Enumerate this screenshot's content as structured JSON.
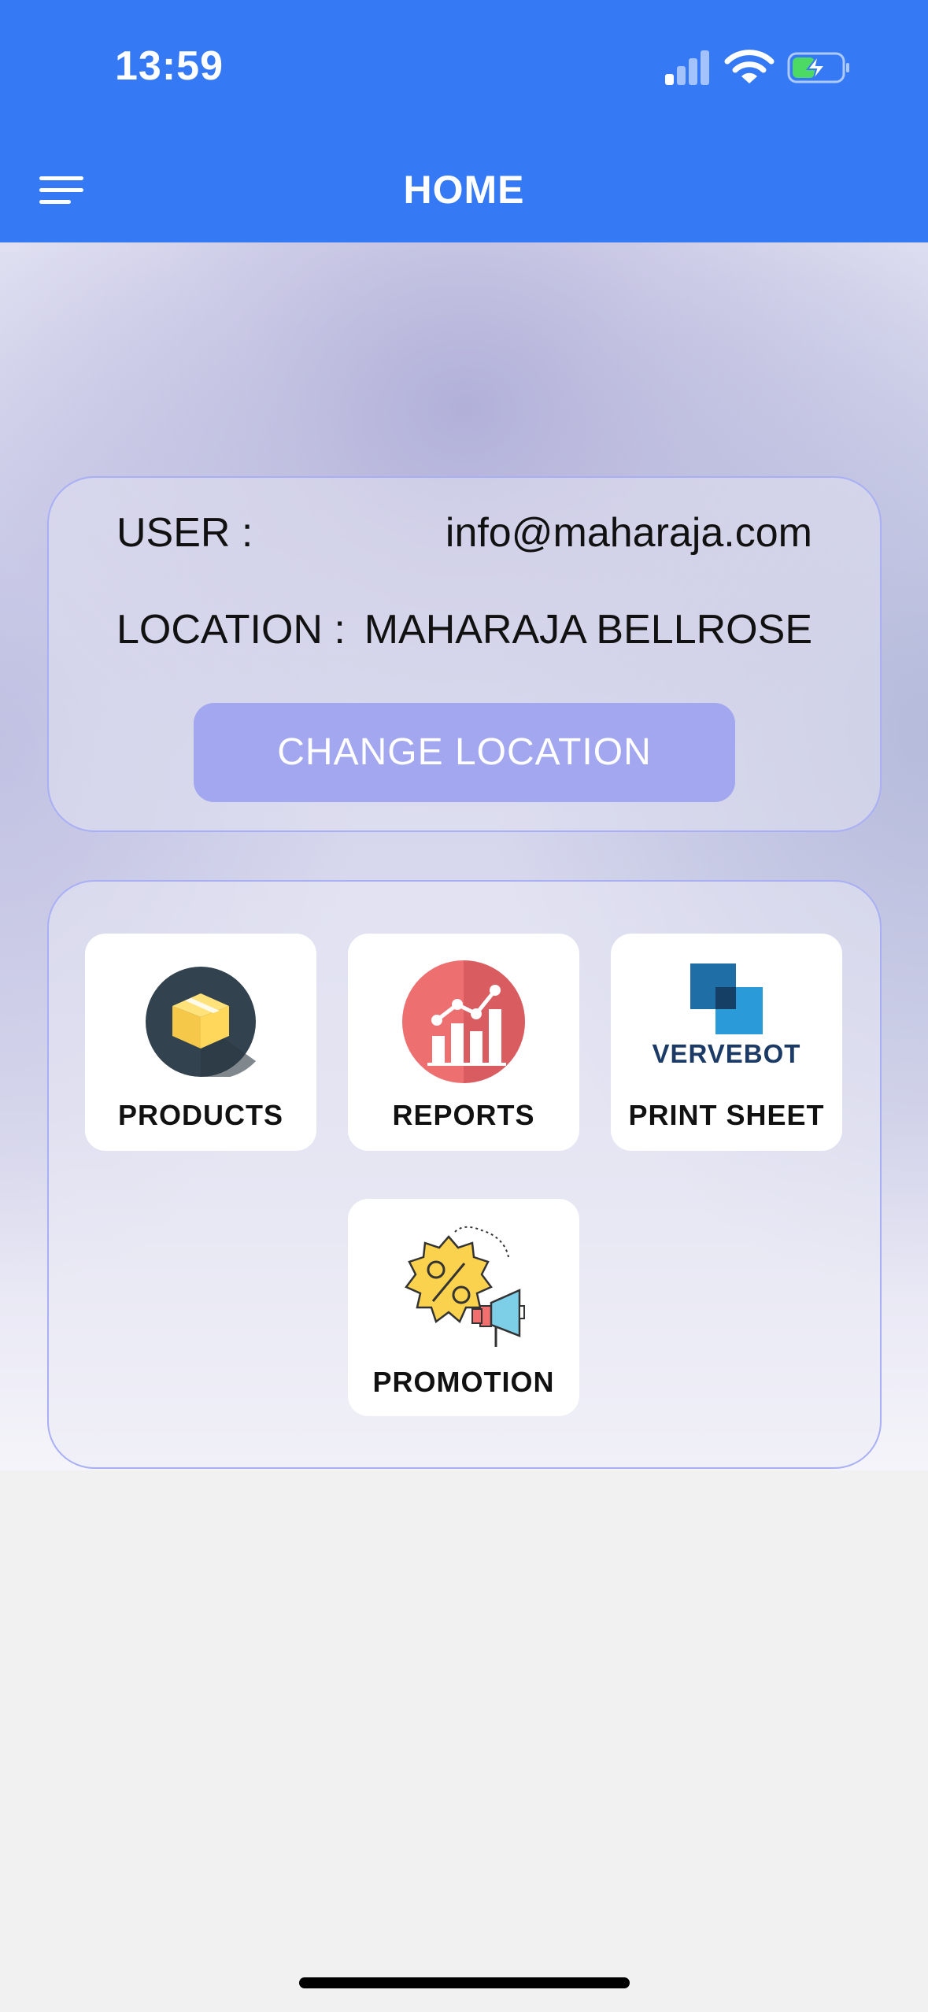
{
  "status_bar": {
    "time": "13:59"
  },
  "header": {
    "title": "HOME"
  },
  "info": {
    "user_label": "USER :",
    "user_value": "info@maharaja.com",
    "location_label": "LOCATION :",
    "location_value": "MAHARAJA BELLROSE",
    "change_location_label": "CHANGE LOCATION"
  },
  "tiles": [
    {
      "label": "PRODUCTS",
      "icon": "product-box-icon"
    },
    {
      "label": "REPORTS",
      "icon": "report-chart-icon"
    },
    {
      "label": "PRINT SHEET",
      "icon": "vervebot-logo",
      "logo_text": "VERVEBOT"
    },
    {
      "label": "PROMOTION",
      "icon": "promotion-megaphone-icon"
    }
  ],
  "colors": {
    "header": "#3679f5",
    "button": "#a3a7ef",
    "card_border": "#a9aff4"
  }
}
